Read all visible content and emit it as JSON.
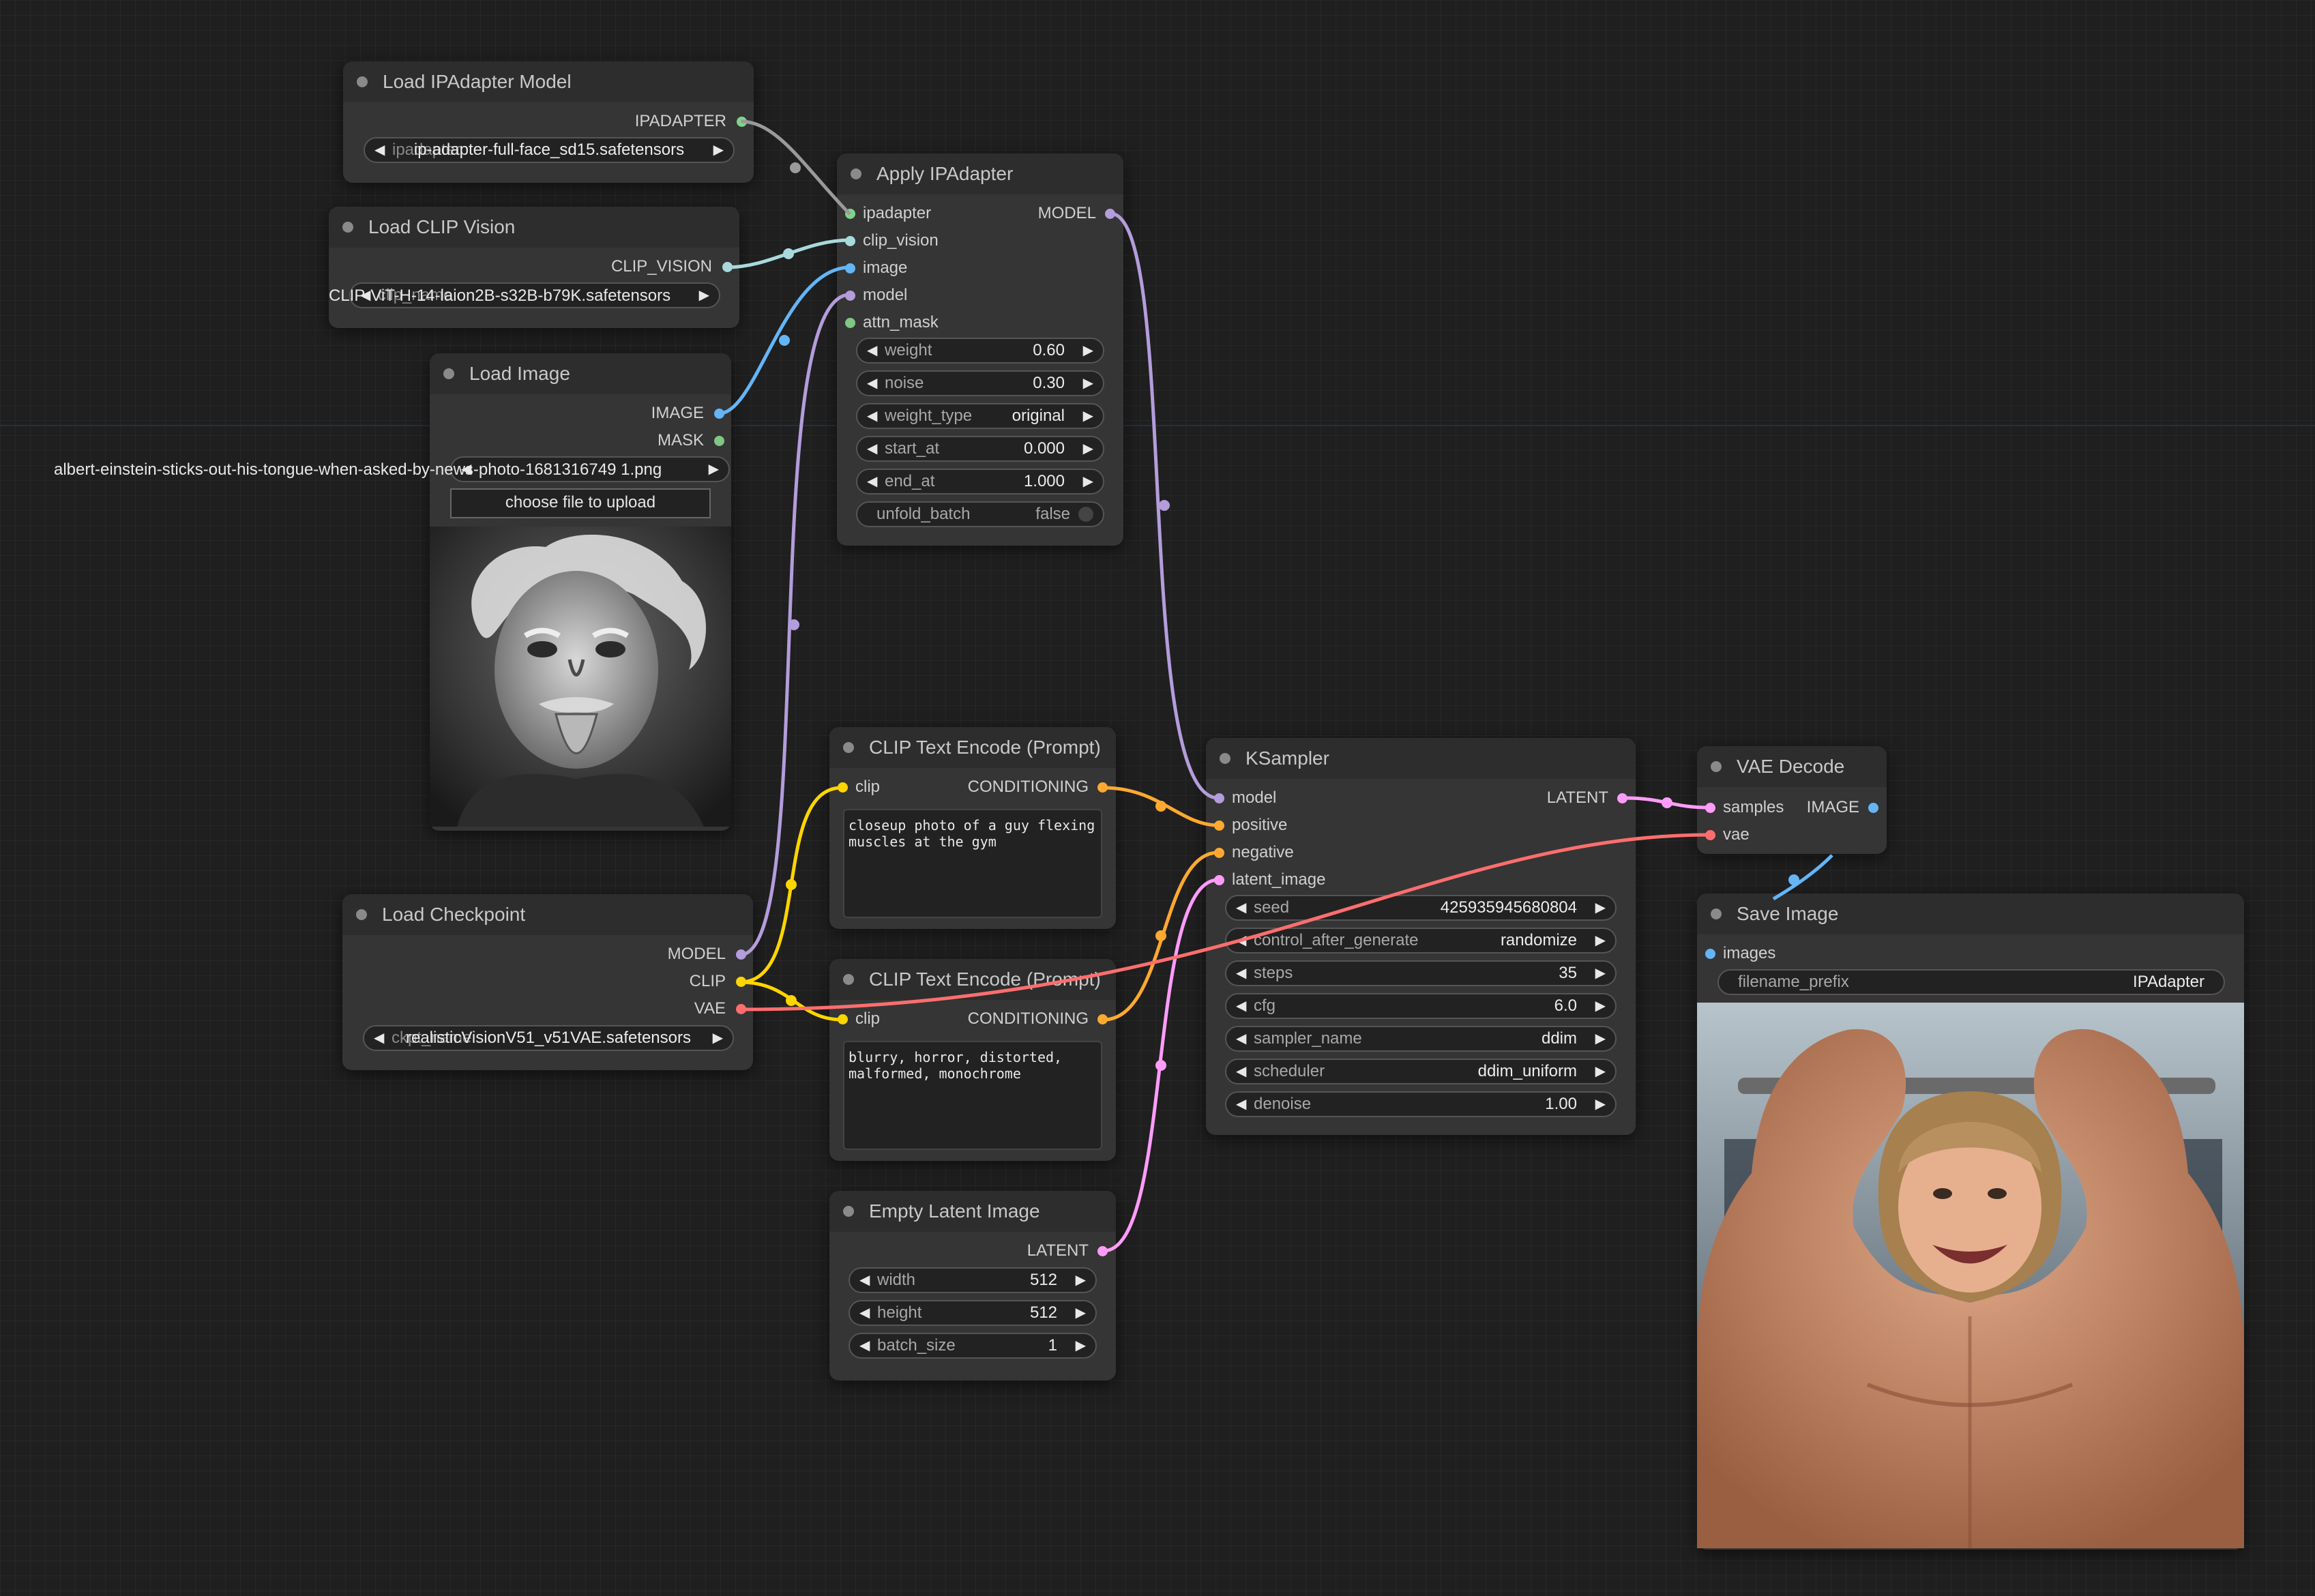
{
  "colors": {
    "background": "#1f1f1f",
    "node_body": "#353535",
    "node_title": "#2d2d2d",
    "ipadapter": "#7fd48a",
    "clip_vision": "#a8dadc",
    "image": "#64b5f6",
    "model": "#b39ddb",
    "mask": "#81c784",
    "clip": "#ffd500",
    "conditioning": "#ffa931",
    "vae": "#ff6e6e",
    "latent": "#ff9cf9"
  },
  "nodes": {
    "load_ipadapter": {
      "title": "Load IPAdapter Model",
      "output": "IPADAPTER",
      "model_name_overlap": "ipadapter",
      "model_name": "ip-adapter-full-face_sd15.safetensors"
    },
    "load_clip_vision": {
      "title": "Load CLIP Vision",
      "output": "CLIP_VISION",
      "clip_name_overlap": "clip_name",
      "clip_name": "CLIP-ViT-H-14-laion2B-s32B-b79K.safetensors"
    },
    "load_image": {
      "title": "Load Image",
      "outputs": [
        "IMAGE",
        "MASK"
      ],
      "image_file": "albert-einstein-sticks-out-his-tongue-when-asked-by-news-photo-1681316749 1.png",
      "image_overlap": "image",
      "upload_label": "choose file to upload",
      "preview_icon": "einstein-portrait-photo"
    },
    "apply_ipadapter": {
      "title": "Apply IPAdapter",
      "inputs": [
        "ipadapter",
        "clip_vision",
        "image",
        "model",
        "attn_mask"
      ],
      "output": "MODEL",
      "widgets": [
        {
          "label": "weight",
          "value": "0.60"
        },
        {
          "label": "noise",
          "value": "0.30"
        },
        {
          "label": "weight_type",
          "value": "original"
        },
        {
          "label": "start_at",
          "value": "0.000"
        },
        {
          "label": "end_at",
          "value": "1.000"
        }
      ],
      "unfold_batch": {
        "label": "unfold_batch",
        "value": "false"
      }
    },
    "clip_text_positive": {
      "title": "CLIP Text Encode (Prompt)",
      "input": "clip",
      "output": "CONDITIONING",
      "text": "closeup photo of a guy flexing muscles at the gym"
    },
    "clip_text_negative": {
      "title": "CLIP Text Encode (Prompt)",
      "input": "clip",
      "output": "CONDITIONING",
      "text": "blurry, horror, distorted, malformed, monochrome"
    },
    "load_checkpoint": {
      "title": "Load Checkpoint",
      "outputs": [
        "MODEL",
        "CLIP",
        "VAE"
      ],
      "ckpt_overlap": "ckpt_name",
      "ckpt_name": "realisticVisionV51_v51VAE.safetensors"
    },
    "empty_latent": {
      "title": "Empty Latent Image",
      "output": "LATENT",
      "widgets": [
        {
          "label": "width",
          "value": "512"
        },
        {
          "label": "height",
          "value": "512"
        },
        {
          "label": "batch_size",
          "value": "1"
        }
      ]
    },
    "ksampler": {
      "title": "KSampler",
      "inputs": [
        "model",
        "positive",
        "negative",
        "latent_image"
      ],
      "output": "LATENT",
      "widgets": [
        {
          "label": "seed",
          "value": "425935945680804"
        },
        {
          "label": "control_after_generate",
          "value": "randomize"
        },
        {
          "label": "steps",
          "value": "35"
        },
        {
          "label": "cfg",
          "value": "6.0"
        },
        {
          "label": "sampler_name",
          "value": "ddim"
        },
        {
          "label": "scheduler",
          "value": "ddim_uniform"
        },
        {
          "label": "denoise",
          "value": "1.00"
        }
      ]
    },
    "vae_decode": {
      "title": "VAE Decode",
      "inputs": [
        "samples",
        "vae"
      ],
      "output": "IMAGE"
    },
    "save_image": {
      "title": "Save Image",
      "input": "images",
      "filename_prefix_label": "filename_prefix",
      "filename_prefix": "IPAdapter",
      "preview_icon": "muscular-man-gym-photo"
    }
  },
  "arrows": {
    "left": "◀",
    "right": "▶"
  }
}
